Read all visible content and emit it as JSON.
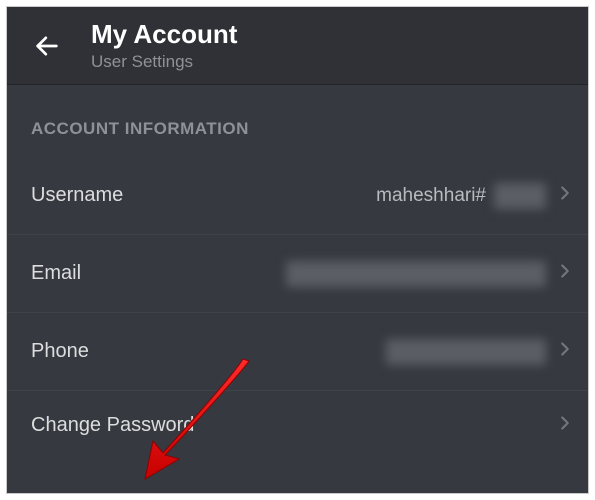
{
  "header": {
    "title": "My Account",
    "subtitle": "User Settings"
  },
  "section_heading": "ACCOUNT INFORMATION",
  "rows": {
    "username": {
      "label": "Username",
      "value_prefix": "maheshhari#"
    },
    "email": {
      "label": "Email"
    },
    "phone": {
      "label": "Phone"
    },
    "password": {
      "label": "Change Password"
    }
  }
}
